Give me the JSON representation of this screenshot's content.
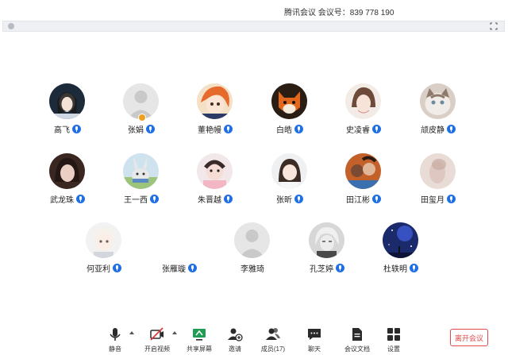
{
  "window": {
    "title": "腾讯会议 会议号：839 778 190"
  },
  "colors": {
    "accent": "#1e6fe8",
    "leave": "#e04a4a",
    "host_badge": "#f0a020"
  },
  "participants": [
    {
      "name": "高飞",
      "avatar": "girl-dark-bg"
    },
    {
      "name": "张娟",
      "avatar": "default-silhouette",
      "host": true
    },
    {
      "name": "董艳幔",
      "avatar": "anime-orange-hair"
    },
    {
      "name": "白皓",
      "avatar": "cartoon-fox"
    },
    {
      "name": "史凌睿",
      "avatar": "girl-portrait"
    },
    {
      "name": "颃皮静",
      "avatar": "cat-photo"
    },
    {
      "name": "武龙珠",
      "avatar": "girl-dark-photo"
    },
    {
      "name": "王一西",
      "avatar": "cartoon-rabbit"
    },
    {
      "name": "朱晋越",
      "avatar": "baby-photo"
    },
    {
      "name": "张昕",
      "avatar": "girl-light-photo"
    },
    {
      "name": "田江彬",
      "avatar": "group-photo"
    },
    {
      "name": "田玺月",
      "avatar": "blurred-photo"
    },
    {
      "name": "何亚利",
      "avatar": "anime-boy-white"
    },
    {
      "name": "张雁璇",
      "avatar": "none"
    },
    {
      "name": "李雅琦",
      "avatar": "default-silhouette"
    },
    {
      "name": "孔芝婷",
      "avatar": "anime-boy-grey"
    },
    {
      "name": "杜轶明",
      "avatar": "starry-sky"
    }
  ],
  "toolbar": {
    "mute": "静音",
    "video": "开启视频",
    "share": "共享屏幕",
    "invite": "邀请",
    "members": "成员(17)",
    "chat": "聊天",
    "docs": "会议文档",
    "settings": "设置",
    "leave": "离开会议"
  }
}
